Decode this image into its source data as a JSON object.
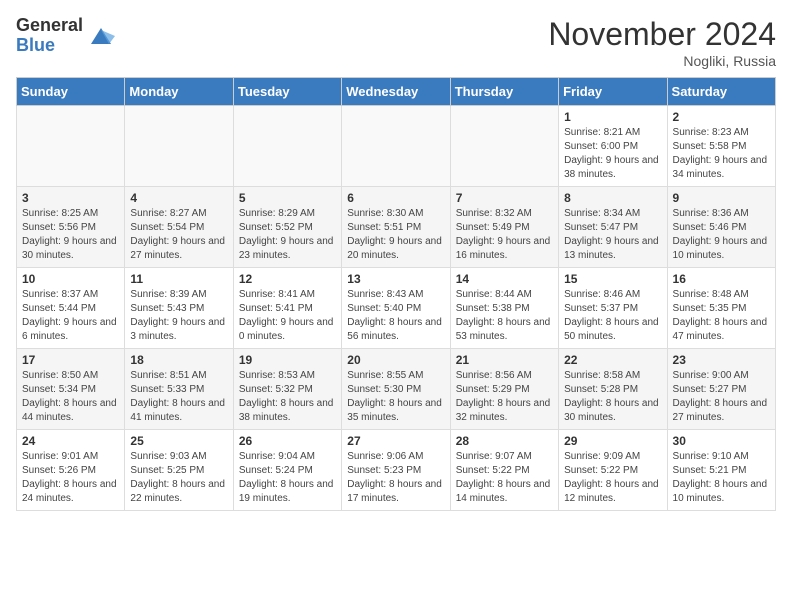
{
  "logo": {
    "general": "General",
    "blue": "Blue"
  },
  "header": {
    "month": "November 2024",
    "location": "Nogliki, Russia"
  },
  "days_of_week": [
    "Sunday",
    "Monday",
    "Tuesday",
    "Wednesday",
    "Thursday",
    "Friday",
    "Saturday"
  ],
  "weeks": [
    [
      {
        "day": "",
        "info": ""
      },
      {
        "day": "",
        "info": ""
      },
      {
        "day": "",
        "info": ""
      },
      {
        "day": "",
        "info": ""
      },
      {
        "day": "",
        "info": ""
      },
      {
        "day": "1",
        "info": "Sunrise: 8:21 AM\nSunset: 6:00 PM\nDaylight: 9 hours and 38 minutes."
      },
      {
        "day": "2",
        "info": "Sunrise: 8:23 AM\nSunset: 5:58 PM\nDaylight: 9 hours and 34 minutes."
      }
    ],
    [
      {
        "day": "3",
        "info": "Sunrise: 8:25 AM\nSunset: 5:56 PM\nDaylight: 9 hours and 30 minutes."
      },
      {
        "day": "4",
        "info": "Sunrise: 8:27 AM\nSunset: 5:54 PM\nDaylight: 9 hours and 27 minutes."
      },
      {
        "day": "5",
        "info": "Sunrise: 8:29 AM\nSunset: 5:52 PM\nDaylight: 9 hours and 23 minutes."
      },
      {
        "day": "6",
        "info": "Sunrise: 8:30 AM\nSunset: 5:51 PM\nDaylight: 9 hours and 20 minutes."
      },
      {
        "day": "7",
        "info": "Sunrise: 8:32 AM\nSunset: 5:49 PM\nDaylight: 9 hours and 16 minutes."
      },
      {
        "day": "8",
        "info": "Sunrise: 8:34 AM\nSunset: 5:47 PM\nDaylight: 9 hours and 13 minutes."
      },
      {
        "day": "9",
        "info": "Sunrise: 8:36 AM\nSunset: 5:46 PM\nDaylight: 9 hours and 10 minutes."
      }
    ],
    [
      {
        "day": "10",
        "info": "Sunrise: 8:37 AM\nSunset: 5:44 PM\nDaylight: 9 hours and 6 minutes."
      },
      {
        "day": "11",
        "info": "Sunrise: 8:39 AM\nSunset: 5:43 PM\nDaylight: 9 hours and 3 minutes."
      },
      {
        "day": "12",
        "info": "Sunrise: 8:41 AM\nSunset: 5:41 PM\nDaylight: 9 hours and 0 minutes."
      },
      {
        "day": "13",
        "info": "Sunrise: 8:43 AM\nSunset: 5:40 PM\nDaylight: 8 hours and 56 minutes."
      },
      {
        "day": "14",
        "info": "Sunrise: 8:44 AM\nSunset: 5:38 PM\nDaylight: 8 hours and 53 minutes."
      },
      {
        "day": "15",
        "info": "Sunrise: 8:46 AM\nSunset: 5:37 PM\nDaylight: 8 hours and 50 minutes."
      },
      {
        "day": "16",
        "info": "Sunrise: 8:48 AM\nSunset: 5:35 PM\nDaylight: 8 hours and 47 minutes."
      }
    ],
    [
      {
        "day": "17",
        "info": "Sunrise: 8:50 AM\nSunset: 5:34 PM\nDaylight: 8 hours and 44 minutes."
      },
      {
        "day": "18",
        "info": "Sunrise: 8:51 AM\nSunset: 5:33 PM\nDaylight: 8 hours and 41 minutes."
      },
      {
        "day": "19",
        "info": "Sunrise: 8:53 AM\nSunset: 5:32 PM\nDaylight: 8 hours and 38 minutes."
      },
      {
        "day": "20",
        "info": "Sunrise: 8:55 AM\nSunset: 5:30 PM\nDaylight: 8 hours and 35 minutes."
      },
      {
        "day": "21",
        "info": "Sunrise: 8:56 AM\nSunset: 5:29 PM\nDaylight: 8 hours and 32 minutes."
      },
      {
        "day": "22",
        "info": "Sunrise: 8:58 AM\nSunset: 5:28 PM\nDaylight: 8 hours and 30 minutes."
      },
      {
        "day": "23",
        "info": "Sunrise: 9:00 AM\nSunset: 5:27 PM\nDaylight: 8 hours and 27 minutes."
      }
    ],
    [
      {
        "day": "24",
        "info": "Sunrise: 9:01 AM\nSunset: 5:26 PM\nDaylight: 8 hours and 24 minutes."
      },
      {
        "day": "25",
        "info": "Sunrise: 9:03 AM\nSunset: 5:25 PM\nDaylight: 8 hours and 22 minutes."
      },
      {
        "day": "26",
        "info": "Sunrise: 9:04 AM\nSunset: 5:24 PM\nDaylight: 8 hours and 19 minutes."
      },
      {
        "day": "27",
        "info": "Sunrise: 9:06 AM\nSunset: 5:23 PM\nDaylight: 8 hours and 17 minutes."
      },
      {
        "day": "28",
        "info": "Sunrise: 9:07 AM\nSunset: 5:22 PM\nDaylight: 8 hours and 14 minutes."
      },
      {
        "day": "29",
        "info": "Sunrise: 9:09 AM\nSunset: 5:22 PM\nDaylight: 8 hours and 12 minutes."
      },
      {
        "day": "30",
        "info": "Sunrise: 9:10 AM\nSunset: 5:21 PM\nDaylight: 8 hours and 10 minutes."
      }
    ]
  ]
}
